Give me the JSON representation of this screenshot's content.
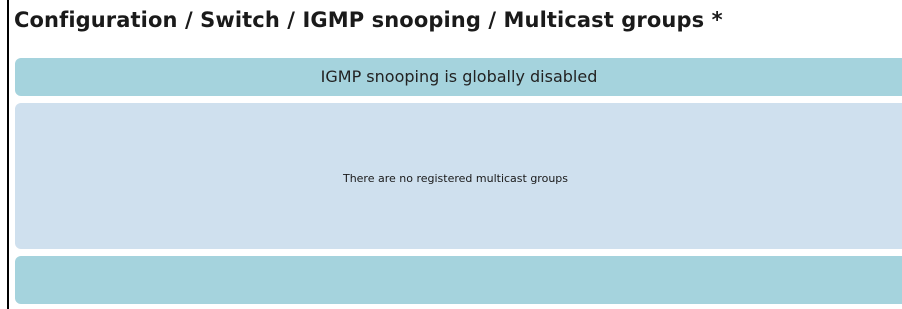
{
  "page": {
    "title": "Configuration / Switch / IGMP snooping / Multicast groups *"
  },
  "status": {
    "message": "IGMP snooping is globally disabled"
  },
  "groups": {
    "empty_message": "There are no registered multicast groups"
  },
  "colors": {
    "banner": "#a5d3dd",
    "panel": "#cfe0ee",
    "text": "#1a1a1a"
  }
}
